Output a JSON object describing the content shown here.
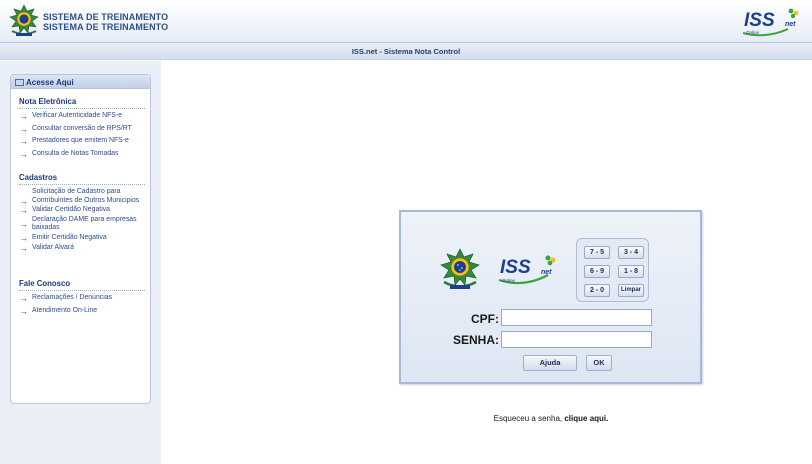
{
  "header": {
    "system_title_1": "SISTEMA DE TREINAMENTO",
    "system_title_2": "SISTEMA DE TREINAMENTO",
    "logo_text": "ISS",
    "logo_suffix": "net",
    "logo_sub": "Online"
  },
  "subbar": {
    "title": "ISS.net - Sistema Nota Control"
  },
  "sidebar": {
    "title": "Acesse Aqui",
    "sections": [
      {
        "title": "Nota Eletrônica",
        "items": [
          "Verificar Autenticidade NFS-e",
          "Consultar conversão de RPS/RT",
          "Prestadores que emitem NFS-e",
          "Consulta de Notas Tomadas"
        ]
      },
      {
        "title": "Cadastros",
        "items": [
          "Solicitação de Cadastro para Contribuintes de Outros Municipios",
          "Validar Certidão Negativa",
          "Declaração DAME para empresas baixadas",
          "Emitir Certidão Negativa",
          "Validar Alvará"
        ]
      },
      {
        "title": "Fale Conosco",
        "items": [
          "Reclamações / Denúncias",
          "Atendimento On-Line"
        ]
      }
    ]
  },
  "login": {
    "keypad": [
      "7 - 5",
      "3 - 4",
      "6 - 9",
      "1 - 8",
      "2 - 0",
      "Limpar"
    ],
    "cpf_label": "CPF:",
    "cpf_value": "",
    "senha_label": "SENHA:",
    "senha_value": "",
    "ajuda_label": "Ajuda",
    "ok_label": "OK"
  },
  "forgot": {
    "text": "Esqueceu a senha,",
    "link": "clique aqui."
  },
  "colors": {
    "accent": "#2e4c8c",
    "logo_blue": "#1d3f8f",
    "logo_green": "#3aa33a",
    "logo_yellow": "#f3c21a"
  }
}
